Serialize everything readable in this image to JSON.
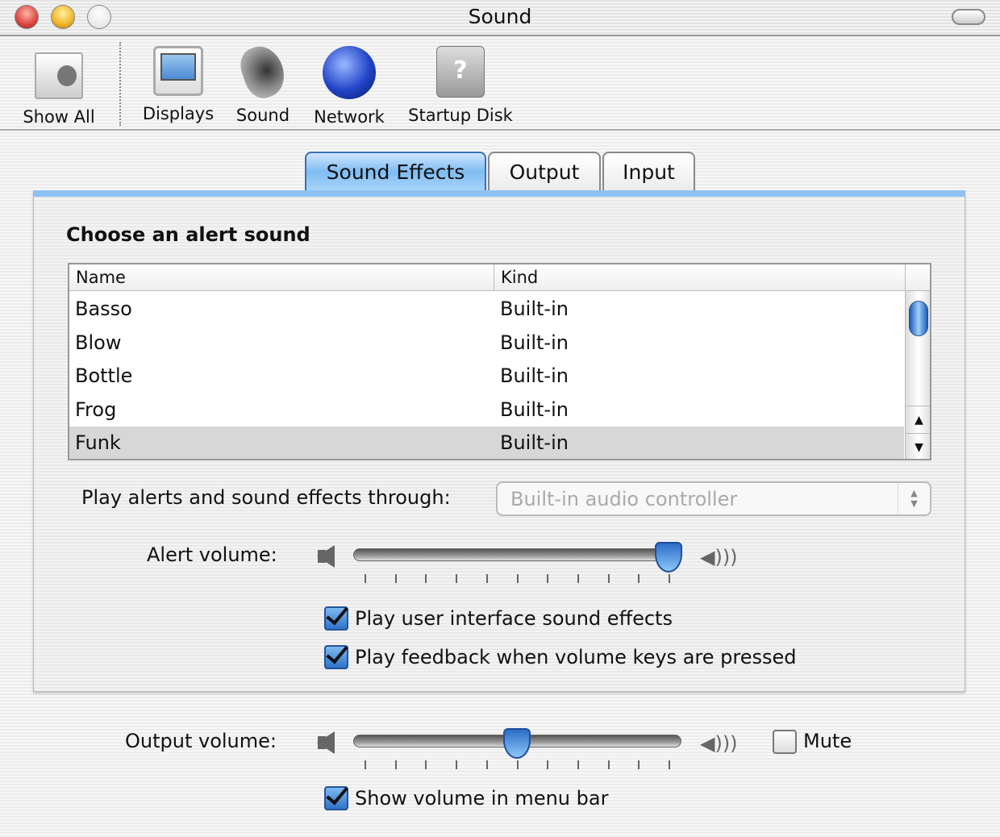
{
  "window": {
    "title": "Sound"
  },
  "toolbar": {
    "items": [
      {
        "label": "Show All",
        "icon": "apple-switch-icon"
      },
      {
        "label": "Displays",
        "icon": "display-icon"
      },
      {
        "label": "Sound",
        "icon": "speaker-icon"
      },
      {
        "label": "Network",
        "icon": "globe-icon"
      },
      {
        "label": "Startup Disk",
        "icon": "hard-disk-icon"
      }
    ]
  },
  "tabs": [
    {
      "label": "Sound Effects",
      "selected": true
    },
    {
      "label": "Output"
    },
    {
      "label": "Input"
    }
  ],
  "sound_effects": {
    "heading": "Choose an alert sound",
    "columns": [
      "Name",
      "Kind"
    ],
    "rows": [
      {
        "name": "Basso",
        "kind": "Built-in"
      },
      {
        "name": "Blow",
        "kind": "Built-in"
      },
      {
        "name": "Bottle",
        "kind": "Built-in"
      },
      {
        "name": "Frog",
        "kind": "Built-in"
      },
      {
        "name": "Funk",
        "kind": "Built-in",
        "selected": true
      }
    ],
    "play_through_label": "Play alerts and sound effects through:",
    "play_through_value": "Built-in audio controller",
    "alert_volume_label": "Alert volume:",
    "alert_volume": 1.0,
    "ui_effects_label": "Play user interface sound effects",
    "ui_effects_checked": true,
    "feedback_label": "Play feedback when volume keys are pressed",
    "feedback_checked": true
  },
  "output_volume_label": "Output volume:",
  "output_volume": 0.5,
  "mute_label": "Mute",
  "mute_checked": false,
  "show_menu_label": "Show volume in menu bar",
  "show_menu_checked": true,
  "colors": {
    "accent": "#3b7fd6",
    "close": "#d9473f",
    "minimize": "#f0b528"
  }
}
